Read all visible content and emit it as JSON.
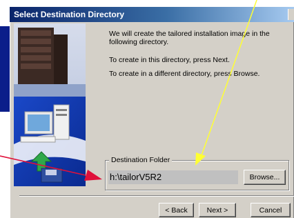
{
  "window": {
    "title": "Select Destination Directory"
  },
  "messages": {
    "line1": "We will create the tailored installation image in the following directory.",
    "line2": "To create in this directory, press Next.",
    "line3": "To create in a different directory, press Browse."
  },
  "destination": {
    "group_label": "Destination Folder",
    "path": "h:\\tailorV5R2",
    "browse_label": "Browse..."
  },
  "buttons": {
    "back_label": "< Back",
    "next_label": "Next >",
    "cancel_label": "Cancel"
  },
  "annotations": {
    "yellow_arrow_color": "#ffff33",
    "red_arrow_color": "#e0103a"
  },
  "colors": {
    "title_gradient_start": "#0a246a",
    "title_gradient_end": "#a6caf0",
    "dialog_face": "#d4d0c8",
    "desktop_blue": "#0b1e8a"
  }
}
